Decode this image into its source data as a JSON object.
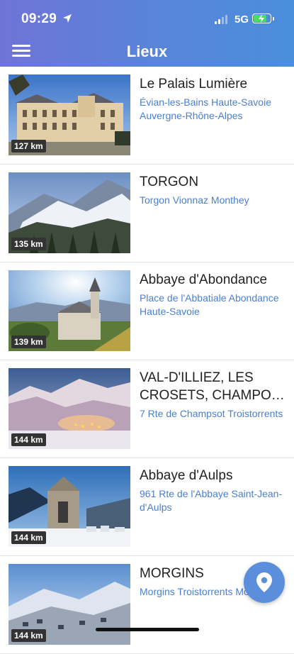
{
  "status": {
    "time": "09:29",
    "network": "5G"
  },
  "header": {
    "title": "Lieux"
  },
  "places": [
    {
      "name": "Le Palais Lumière",
      "address": "Évian-les-Bains Haute-Savoie Auvergne-Rhône-Alpes",
      "distance": "127 km"
    },
    {
      "name": "TORGON",
      "address": "Torgon Vionnaz Monthey",
      "distance": "135 km"
    },
    {
      "name": "Abbaye d'Abondance",
      "address": "Place de l'Abbatiale Abondance Haute-Savoie",
      "distance": "139 km"
    },
    {
      "name": "VAL-D'ILLIEZ, LES CROSETS, CHAMPO…",
      "address": "7 Rte de Champsot Troistorrents",
      "distance": "144 km"
    },
    {
      "name": "Abbaye d'Aulps",
      "address": "961 Rte de l'Abbaye Saint-Jean-d'Aulps",
      "distance": "144 km"
    },
    {
      "name": "MORGINS",
      "address": "Morgins Troistorrents Monthey",
      "distance": "144 km"
    }
  ],
  "icons": {
    "menu": "hamburger-icon",
    "map": "location-pin-icon",
    "location": "location-arrow-icon"
  },
  "colors": {
    "header_start": "#6f73d8",
    "header_end": "#4a8fdb",
    "link": "#4a7fd0",
    "fab": "#5b8edb"
  }
}
